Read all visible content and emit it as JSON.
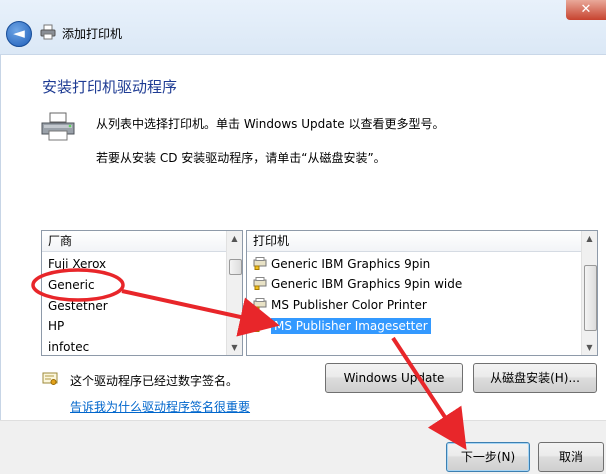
{
  "window": {
    "title": "添加打印机",
    "close_glyph": "✕",
    "back_glyph": "◄"
  },
  "page": {
    "heading": "安装打印机驱动程序",
    "instruction1": "从列表中选择打印机。单击 Windows Update 以查看更多型号。",
    "instruction2": "若要从安装 CD 安装驱动程序，请单击“从磁盘安装”。"
  },
  "manufacturers": {
    "header": "厂商",
    "items": [
      "Fuji Xerox",
      "Generic",
      "Gestetner",
      "HP",
      "infotec"
    ],
    "highlighted": "Generic"
  },
  "printers": {
    "header": "打印机",
    "items": [
      "Generic IBM Graphics 9pin",
      "Generic IBM Graphics 9pin wide",
      "MS Publisher Color Printer",
      "MS Publisher Imagesetter"
    ],
    "selected": "MS Publisher Imagesetter"
  },
  "signature": {
    "text": "这个驱动程序已经过数字签名。",
    "link": "告诉我为什么驱动程序签名很重要"
  },
  "buttons": {
    "windows_update": "Windows Update",
    "have_disk": "从磁盘安装(H)...",
    "next": "下一步(N)",
    "cancel": "取消"
  },
  "colors": {
    "heading": "#1e3b93",
    "selection": "#3399ff",
    "annotation": "#e8262a",
    "link": "#0066cc"
  }
}
